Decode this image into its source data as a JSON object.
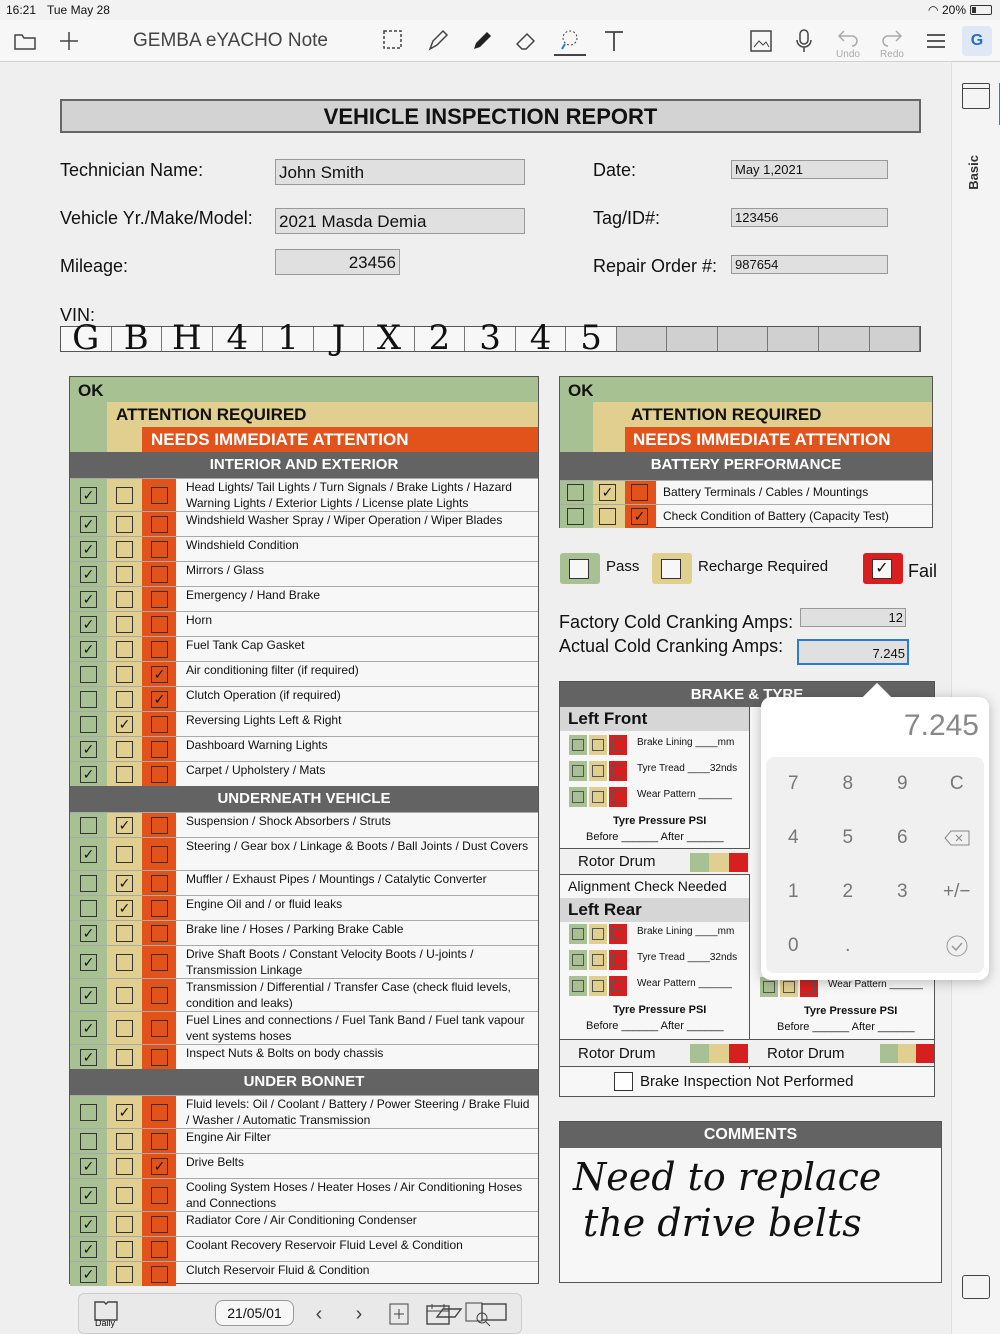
{
  "status": {
    "time": "16:21",
    "date": "Tue May 28",
    "battery": "20%"
  },
  "toolbar": {
    "title": "GEMBA eYACHO Note",
    "undo": "Undo",
    "redo": "Redo"
  },
  "rail": {
    "tab": "Basic"
  },
  "form": {
    "title": "VEHICLE INSPECTION REPORT",
    "tech_label": "Technician Name:",
    "tech_value": "John Smith",
    "vehicle_label": "Vehicle Yr./Make/Model:",
    "vehicle_value": "2021 Masda Demia",
    "mileage_label": "Mileage:",
    "mileage_value": "23456",
    "date_label": "Date:",
    "date_value": "May 1,2021",
    "tag_label": "Tag/ID#:",
    "tag_value": "123456",
    "ro_label": "Repair Order #:",
    "ro_value": "987654",
    "vin_label": "VIN:",
    "vin_chars": [
      "G",
      "B",
      "H",
      "4",
      "1",
      "J",
      "X",
      "2",
      "3",
      "4",
      "5",
      "",
      "",
      "",
      "",
      "",
      ""
    ]
  },
  "legend": {
    "ok": "OK",
    "attention": "ATTENTION REQUIRED",
    "immediate": "NEEDS IMMEDIATE ATTENTION"
  },
  "left_sections": [
    {
      "title": "INTERIOR AND EXTERIOR",
      "items": [
        {
          "text": "Head Lights/ Tail Lights / Turn Signals / Brake Lights / Hazard Warning Lights / Exterior Lights / License plate Lights",
          "state": "ok"
        },
        {
          "text": "Windshield Washer Spray  / Wiper Operation / Wiper Blades",
          "state": "ok"
        },
        {
          "text": "Windshield Condition",
          "state": "ok"
        },
        {
          "text": "Mirrors / Glass",
          "state": "ok"
        },
        {
          "text": "Emergency / Hand Brake",
          "state": "ok"
        },
        {
          "text": "Horn",
          "state": "ok"
        },
        {
          "text": "Fuel Tank Cap Gasket",
          "state": "ok"
        },
        {
          "text": "Air conditioning filter (if required)",
          "state": "bad"
        },
        {
          "text": "Clutch Operation (if required)",
          "state": "bad"
        },
        {
          "text": "Reversing Lights Left & Right",
          "state": "attn"
        },
        {
          "text": "Dashboard Warning Lights",
          "state": "ok"
        },
        {
          "text": "Carpet / Upholstery / Mats",
          "state": "ok"
        }
      ]
    },
    {
      "title": "UNDERNEATH VEHICLE",
      "items": [
        {
          "text": "Suspension / Shock Absorbers / Struts",
          "state": "attn"
        },
        {
          "text": "Steering / Gear box / Linkage & Boots / Ball Joints / Dust Covers",
          "state": "ok"
        },
        {
          "text": "Muffler / Exhaust Pipes / Mountings / Catalytic Converter",
          "state": "attn"
        },
        {
          "text": "Engine Oil and / or fluid leaks",
          "state": "attn"
        },
        {
          "text": "Brake line / Hoses / Parking Brake Cable",
          "state": "ok"
        },
        {
          "text": "Drive Shaft Boots / Constant Velocity Boots / U-joints / Transmission Linkage",
          "state": "ok"
        },
        {
          "text": "Transmission / Differential / Transfer Case (check fluid levels, condition and leaks)",
          "state": "ok"
        },
        {
          "text": "Fuel Lines and connections / Fuel Tank Band / Fuel tank vapour vent systems hoses",
          "state": "ok"
        },
        {
          "text": "Inspect Nuts & Bolts on body chassis",
          "state": "ok"
        }
      ]
    },
    {
      "title": "UNDER BONNET",
      "items": [
        {
          "text": "Fluid levels: Oil / Coolant / Battery / Power Steering / Brake Fluid / Washer / Automatic Transmission",
          "state": "attn"
        },
        {
          "text": "Engine Air Filter",
          "state": "none"
        },
        {
          "text": "Drive Belts",
          "state": "okbad"
        },
        {
          "text": "Cooling System Hoses / Heater Hoses / Air Conditioning Hoses and Connections",
          "state": "ok"
        },
        {
          "text": "Radiator Core / Air Conditioning Condenser",
          "state": "ok"
        },
        {
          "text": "Coolant Recovery Reservoir Fluid Level & Condition",
          "state": "ok"
        },
        {
          "text": "Clutch Reservoir Fluid & Condition",
          "state": "ok"
        }
      ]
    }
  ],
  "battery": {
    "title": "BATTERY PERFORMANCE",
    "items": [
      {
        "text": "Battery Terminals / Cables / Mountings",
        "state": "attn"
      },
      {
        "text": "Check Condition of Battery (Capacity Test)",
        "state": "bad"
      }
    ],
    "pass": "Pass",
    "recharge": "Recharge Required",
    "fail": "Fail",
    "factory_label": "Factory Cold Cranking Amps:",
    "factory_value": "12",
    "actual_label": "Actual Cold Cranking Amps:",
    "actual_value": "7.245"
  },
  "brake": {
    "title": "BRAKE & TYRE",
    "left_front": "Left Front",
    "left_rear": "Left Rear",
    "lining": "Brake Lining ____mm",
    "tread": "Tyre Tread ____32nds",
    "wear": "Wear Pattern ______",
    "pressure": "Tyre Pressure PSI",
    "before_after": "Before ______ After ______",
    "rotor": "Rotor Drum",
    "alignment": "Alignment Check Needed",
    "not_performed": "Brake Inspection Not Performed"
  },
  "comments": {
    "title": "COMMENTS",
    "line1": "Need to replace",
    "line2": "the drive belts"
  },
  "calc": {
    "display": "7.245",
    "keys": [
      "7",
      "8",
      "9",
      "C",
      "4",
      "5",
      "6",
      "⌫",
      "1",
      "2",
      "3",
      "+/−",
      "0",
      ".",
      "",
      ""
    ]
  },
  "bottom": {
    "daily": "Daily",
    "date": "21/05/01"
  }
}
